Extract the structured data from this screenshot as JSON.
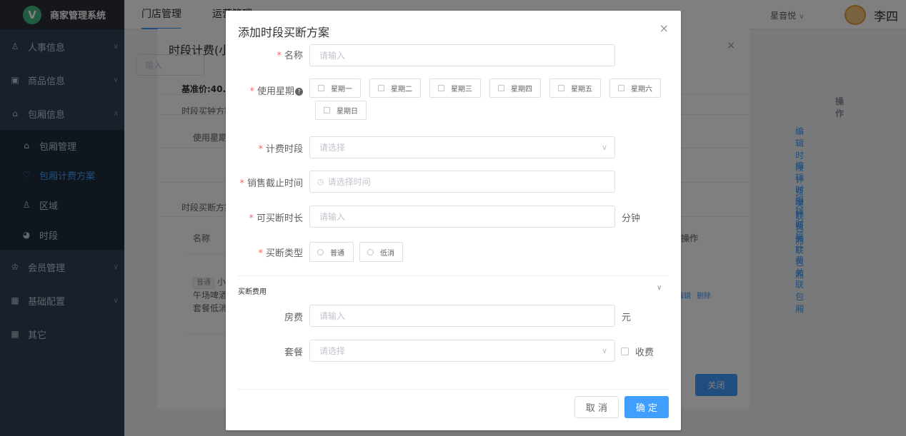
{
  "app": {
    "name": "商家管理系统",
    "logo_letter": "V"
  },
  "sidebar": {
    "items": [
      {
        "label": "人事信息"
      },
      {
        "label": "商品信息"
      },
      {
        "label": "包厢信息"
      },
      {
        "label": "包厢管理"
      },
      {
        "label": "包厢计费方案"
      },
      {
        "label": "区域"
      },
      {
        "label": "时段"
      },
      {
        "label": "会员管理"
      },
      {
        "label": "基础配置"
      },
      {
        "label": "其它"
      }
    ]
  },
  "topbar": {
    "tabs": [
      {
        "label": "门店管理"
      },
      {
        "label": "运营管理"
      }
    ],
    "store": "星音悦",
    "user": "李四"
  },
  "bg_dialog": {
    "title": "时段计费(小",
    "search_placeholder": "输入",
    "base_price": "基准价:40.0",
    "section1": "时段买钟方案",
    "col_weekday": "使用星期",
    "ops_header": "操作",
    "row_links": [
      "编辑",
      "时段计费",
      "关联包厢"
    ],
    "section2": "时段买断方案",
    "col_name": "名称",
    "ops_header2": "操作",
    "tag": "普通",
    "item_line1": "小",
    "item_line2": "午场啤酒",
    "item_line3": "套餐低消",
    "row2_links": [
      "编辑",
      "删除"
    ],
    "close_label": "关闭"
  },
  "modal": {
    "title": "添加时段买断方案",
    "name_label": "名称",
    "name_placeholder": "请输入",
    "weekday_label": "使用星期",
    "weekdays": [
      "星期一",
      "星期二",
      "星期三",
      "星期四",
      "星期五",
      "星期六",
      "星期日"
    ],
    "period_label": "计费时段",
    "period_placeholder": "请选择",
    "deadline_label": "销售截止时间",
    "deadline_placeholder": "请选择时间",
    "duration_label": "可买断时长",
    "duration_placeholder": "请输入",
    "duration_unit": "分钟",
    "type_label": "买断类型",
    "types": [
      "普通",
      "低消"
    ],
    "fee_section": "买断费用",
    "room_fee_label": "房费",
    "room_fee_placeholder": "请输入",
    "room_fee_unit": "元",
    "package_label": "套餐",
    "package_placeholder": "请选择",
    "charge_label": "收费",
    "cancel": "取 消",
    "confirm": "确 定"
  }
}
